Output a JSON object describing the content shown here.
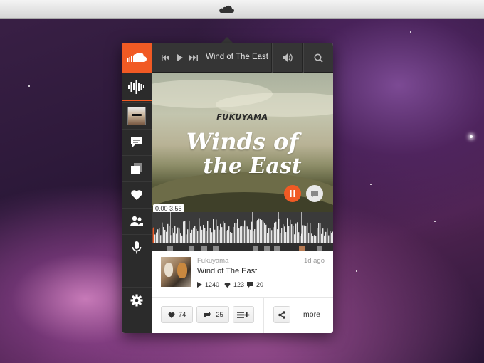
{
  "menubar": {
    "icon": "soundcloud-cloud-icon"
  },
  "player": {
    "track_title": "Wind of The East",
    "controls": [
      "previous-icon",
      "play-icon",
      "next-icon"
    ],
    "volume_icon": "volume-icon",
    "search_icon": "search-icon"
  },
  "sidebar": {
    "items": [
      {
        "name": "stream",
        "icon": "waveform-icon",
        "active": true
      },
      {
        "name": "profile",
        "icon": "avatar"
      },
      {
        "name": "messages",
        "icon": "speech-bubble-icon"
      },
      {
        "name": "sets",
        "icon": "sets-icon"
      },
      {
        "name": "likes",
        "icon": "heart-icon"
      },
      {
        "name": "following",
        "icon": "people-icon"
      },
      {
        "name": "record",
        "icon": "microphone-icon"
      },
      {
        "name": "settings",
        "icon": "gear-icon"
      }
    ],
    "accent": "#f15a24"
  },
  "artwork": {
    "brand": "FUKUYAMA",
    "title_line1": "Winds of",
    "title_line2": "the East"
  },
  "playback": {
    "time": "0.00 3.55",
    "state": "playing"
  },
  "track": {
    "artist": "Fukuyama",
    "title": "Wind of The East",
    "posted": "1d ago",
    "plays": "1240",
    "likes": "123",
    "comments": "20"
  },
  "actions": {
    "like_count": "74",
    "repost_count": "25",
    "more_label": "more"
  },
  "colors": {
    "accent": "#f15a24",
    "sidebar": "#2b2b2b",
    "topbar": "#353535"
  }
}
